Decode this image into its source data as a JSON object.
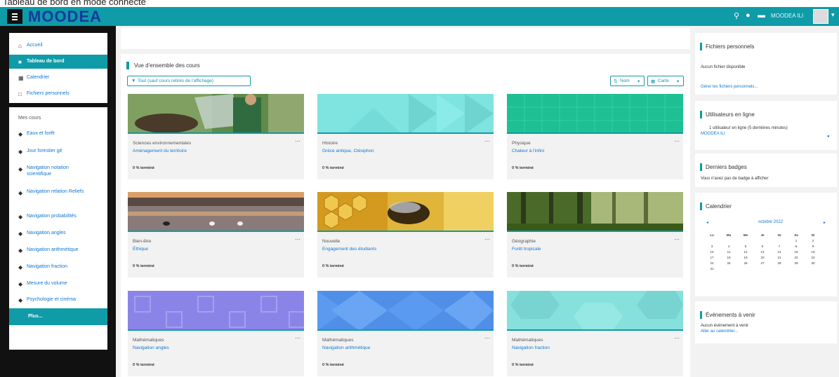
{
  "caption": "Tableau de bord en mode connecté",
  "header": {
    "brand": "MOODEA",
    "user_name": "MOODEA ILI",
    "icons": [
      "search-icon",
      "notification-bell-icon",
      "chat-bubble-icon",
      "chevron-down-icon"
    ]
  },
  "nav": {
    "items": [
      {
        "label": "Accueil",
        "icon": "home-icon"
      },
      {
        "label": "Tableau de bord",
        "icon": "dashboard-icon"
      },
      {
        "label": "Calendrier",
        "icon": "calendar-icon"
      },
      {
        "label": "Fichiers personnels",
        "icon": "file-icon"
      }
    ],
    "courses_heading": "Mes cours",
    "courses": [
      "Eaux et forêt",
      "Jour forestier gé",
      "Navigation notation scientifique",
      "Navigation relation Reliefs",
      "Navigation probabilités",
      "Navigation angles",
      "Navigation arithmétique",
      "Navigation fraction",
      "Mesure du volume",
      "Psychologie et cinéma"
    ],
    "more_label": "Plus..."
  },
  "overview": {
    "title": "Vue d'ensemble des cours",
    "filter_label": "Tout (sauf cours retirés de l'affichage)",
    "sort_label": "Nom",
    "view_label": "Carte",
    "courses": [
      {
        "category": "Sciences environnementales",
        "name": "Aménagement du territoire",
        "status": "0 % terminé",
        "image": "nature-photo"
      },
      {
        "category": "Histoire",
        "name": "Grèce antique, Ctésiphon",
        "status": "0 % terminé",
        "image": "cyan-pattern"
      },
      {
        "category": "Physique",
        "name": "Chaleur à l'infini",
        "status": "0 % terminé",
        "image": "green-pattern"
      },
      {
        "category": "Bien-être",
        "name": "Éthique",
        "status": "0 % terminé",
        "image": "lake-photo"
      },
      {
        "category": "Nouvelle",
        "name": "Engagement des étudiants",
        "status": "0 % terminé",
        "image": "bee-photo"
      },
      {
        "category": "Géographie",
        "name": "Forêt tropicale",
        "status": "0 % terminé",
        "image": "forest-photo"
      },
      {
        "category": "Mathématiques",
        "name": "Navigation angles",
        "status": "0 % terminé",
        "image": "purple-pattern"
      },
      {
        "category": "Mathématiques",
        "name": "Navigation arithmétique",
        "status": "0 % terminé",
        "image": "blue-pattern"
      },
      {
        "category": "Mathématiques",
        "name": "Navigation fraction",
        "status": "0 % terminé",
        "image": "teal-pattern"
      }
    ]
  },
  "blocks": {
    "files": {
      "title": "Fichiers personnels",
      "text": "Aucun fichier disponible",
      "link": "Gérer les fichiers personnels..."
    },
    "online": {
      "title": "Utilisateurs en ligne",
      "text": "1 utilisateur en ligne (5 dernières minutes)",
      "user": "MOODEA ILI"
    },
    "badges": {
      "title": "Derniers badges",
      "text": "Vous n'avez pas de badge à afficher"
    },
    "calendar": {
      "title": "Calendrier",
      "month": "octobre 2022",
      "prev": "◄",
      "next": "►",
      "days": [
        "Lu",
        "Ma",
        "Me",
        "Je",
        "Ve",
        "Sa",
        "Di"
      ],
      "weeks": [
        [
          "",
          "",
          "",
          "",
          "",
          "1",
          "2"
        ],
        [
          "3",
          "4",
          "5",
          "6",
          "7",
          "8",
          "9"
        ],
        [
          "10",
          "11",
          "12",
          "13",
          "14",
          "15",
          "16"
        ],
        [
          "17",
          "18",
          "19",
          "20",
          "21",
          "22",
          "23"
        ],
        [
          "24",
          "25",
          "26",
          "27",
          "28",
          "29",
          "30"
        ],
        [
          "31",
          "",
          "",
          "",
          "",
          "",
          ""
        ]
      ]
    },
    "events": {
      "title": "Événements à venir",
      "text": "Aucun événement à venir",
      "link": "Aller au calendrier..."
    }
  },
  "colors": {
    "accent": "#0f9ba8",
    "link": "#1177d1",
    "sidebar": "#111111",
    "logo": "#173b9e"
  }
}
